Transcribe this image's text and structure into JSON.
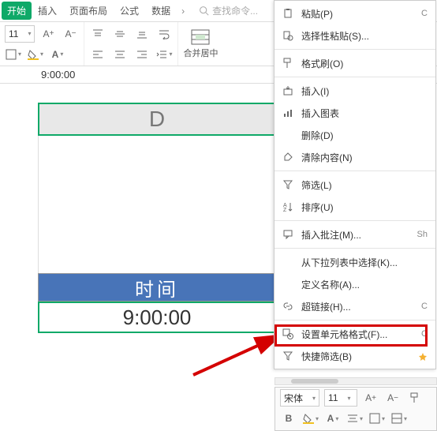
{
  "tabs": {
    "active": "开始",
    "items": [
      "开始",
      "插入",
      "页面布局",
      "公式",
      "数据"
    ],
    "search_placeholder": "查找命令..."
  },
  "toolbar": {
    "font_size": "11",
    "merge_label": "合并居中"
  },
  "formula_bar": {
    "value": "9:00:00"
  },
  "sheet": {
    "column_label": "D",
    "title_cell": "时间",
    "time_cell": "9:00:00"
  },
  "context_menu": {
    "items": [
      {
        "icon": "paste",
        "label": "粘贴(P)",
        "suffix": "C"
      },
      {
        "icon": "paste-special",
        "label": "选择性粘贴(S)...",
        "suffix": ""
      },
      {
        "sep": true
      },
      {
        "icon": "format-painter",
        "label": "格式刷(O)",
        "suffix": ""
      },
      {
        "sep": true
      },
      {
        "icon": "insert",
        "label": "插入(I)",
        "suffix": ""
      },
      {
        "icon": "chart",
        "label": "插入图表",
        "suffix": ""
      },
      {
        "icon": "",
        "label": "删除(D)",
        "suffix": ""
      },
      {
        "icon": "clear",
        "label": "清除内容(N)",
        "suffix": ""
      },
      {
        "sep": true
      },
      {
        "icon": "filter",
        "label": "筛选(L)",
        "suffix": ""
      },
      {
        "icon": "sort",
        "label": "排序(U)",
        "suffix": ""
      },
      {
        "sep": true
      },
      {
        "icon": "comment",
        "label": "插入批注(M)...",
        "suffix": "Sh"
      },
      {
        "sep": true
      },
      {
        "icon": "",
        "label": "从下拉列表中选择(K)...",
        "suffix": ""
      },
      {
        "icon": "",
        "label": "定义名称(A)...",
        "suffix": ""
      },
      {
        "icon": "link",
        "label": "超链接(H)...",
        "suffix": "C"
      },
      {
        "sep": true
      },
      {
        "icon": "cell-format",
        "label": "设置单元格格式(F)...",
        "suffix": "C"
      },
      {
        "icon": "quick-filter",
        "label": "快捷筛选(B)",
        "suffix": "",
        "star": true
      }
    ]
  },
  "bottom_toolbar": {
    "font_name": "宋体",
    "font_size": "11"
  }
}
